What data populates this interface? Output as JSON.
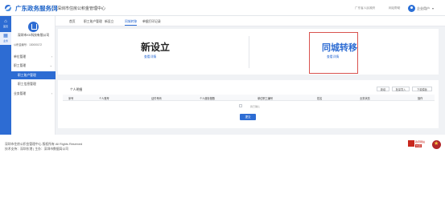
{
  "header": {
    "brand": "广东政务服务网",
    "center_name": "深圳市住房公积金管理中心",
    "links": [
      "广东省人民政府",
      "网站帮助"
    ],
    "user_name": "企业用户",
    "colors": {
      "brand": "#1d63c8",
      "accent": "#2d6cd3"
    }
  },
  "left_strip": {
    "items": [
      {
        "icon": "home-icon",
        "label": "首页"
      },
      {
        "icon": "grid-icon",
        "label": "业务"
      }
    ]
  },
  "sidebar": {
    "org_name": "深圳市XX科技有限公司",
    "org_code": "公积金编号：130000172",
    "menu": [
      {
        "label": "单位管理",
        "expandable": true,
        "active": false,
        "sub": false
      },
      {
        "label": "职工管理",
        "expandable": true,
        "active": false,
        "sub": false
      },
      {
        "label": "职工账户管理",
        "expandable": false,
        "active": true,
        "sub": true
      },
      {
        "label": "职工信息管理",
        "expandable": false,
        "active": false,
        "sub": true
      },
      {
        "label": "业务管理",
        "expandable": true,
        "active": false,
        "sub": false
      }
    ]
  },
  "tabs": [
    "首页",
    "职工账户管理",
    "新设立",
    "同城转移",
    "单据打印记录"
  ],
  "active_tab": "同城转移",
  "top_panel": {
    "new_title": "新设立",
    "new_link": "查看详情",
    "transfer_title": "同城转移",
    "transfer_link": "查看详情"
  },
  "list": {
    "title": "个人明细",
    "buttons": [
      "新增",
      "批量导入",
      "下载模板"
    ],
    "columns": [
      "序号",
      "个人账号",
      "证件号码",
      "个人缴存基数",
      "单位职工编号",
      "姓名",
      "业务状态",
      "操作"
    ],
    "checkbox_label": "我已确认",
    "submit": "提交"
  },
  "footer": {
    "line1": "深圳市住房公积金管理中心 版权所有 All Rights Reserved",
    "line2": "技术支持：深圳东港 | 主办：深圳市数据局公司",
    "badge_line1": "政府网站",
    "badge_line2": "找错"
  }
}
